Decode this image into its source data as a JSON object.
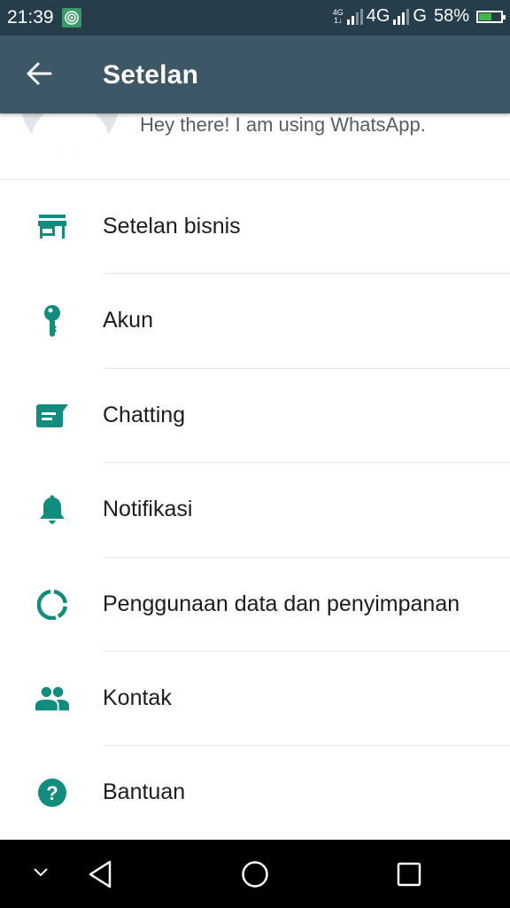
{
  "status_bar": {
    "time": "21:39",
    "network1_label": "4G",
    "network2_label": "G",
    "battery_percent": "58%",
    "battery_level": 0.58
  },
  "app_bar": {
    "back_icon": "arrow-left-icon",
    "title": "Setelan"
  },
  "profile": {
    "status": "Hey there! I am using WhatsApp."
  },
  "menu": {
    "items": [
      {
        "label": "Setelan bisnis",
        "icon": "store-icon"
      },
      {
        "label": "Akun",
        "icon": "key-icon"
      },
      {
        "label": "Chatting",
        "icon": "chat-icon"
      },
      {
        "label": "Notifikasi",
        "icon": "bell-icon"
      },
      {
        "label": "Penggunaan data dan penyimpanan",
        "icon": "data-usage-icon"
      },
      {
        "label": "Kontak",
        "icon": "people-icon"
      },
      {
        "label": "Bantuan",
        "icon": "help-icon"
      }
    ]
  },
  "colors": {
    "accent": "#128c7e",
    "app_bar": "#3d5766",
    "status_bar": "#263d4b"
  },
  "nav_bar": {
    "buttons": [
      "collapse",
      "back",
      "home",
      "recents"
    ]
  }
}
